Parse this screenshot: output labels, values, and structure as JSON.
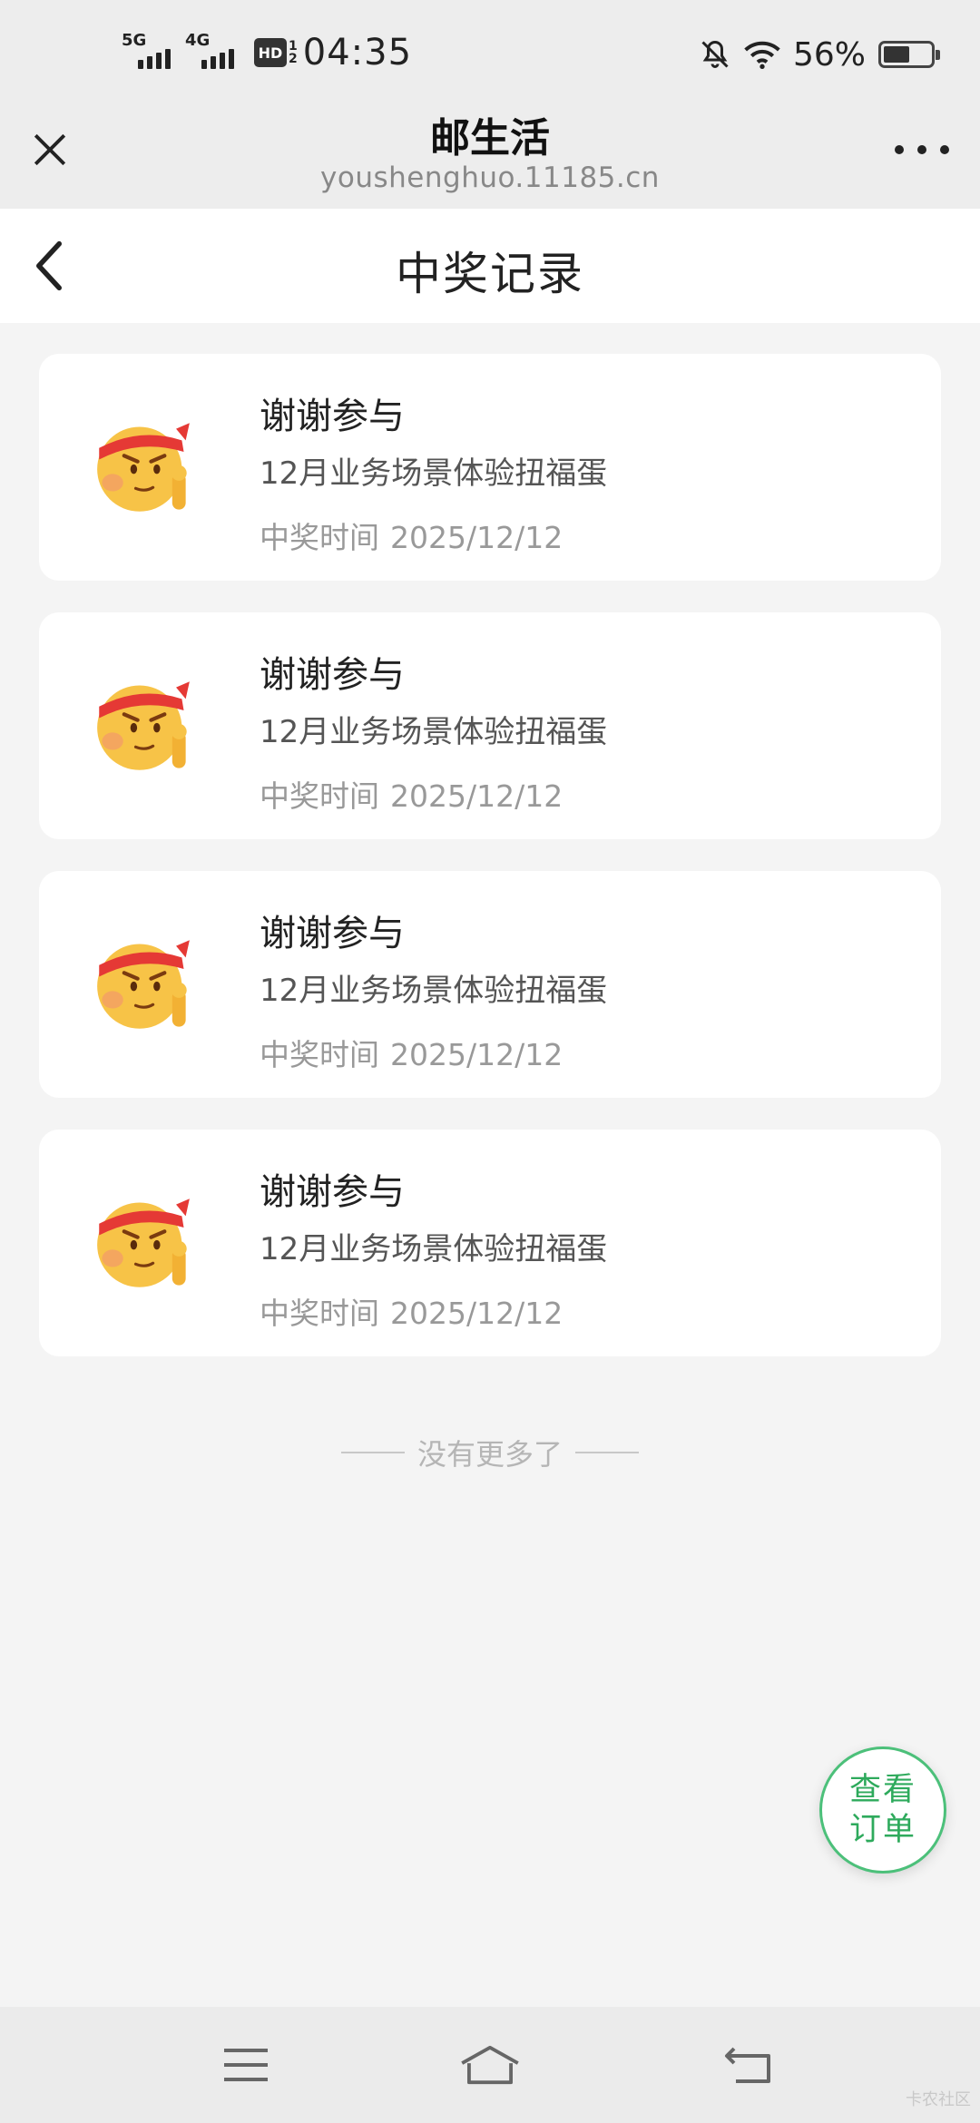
{
  "status_bar": {
    "net1": "5G",
    "net2": "4G",
    "hd": "HD",
    "hd_sub_top": "1",
    "hd_sub_bottom": "2",
    "time": "04:35",
    "battery_percent": "56%",
    "battery_level": 0.56,
    "icons": [
      "mute-bell-icon",
      "wifi-icon",
      "battery-icon"
    ]
  },
  "browser": {
    "title": "邮生活",
    "url": "youshenghuo.11185.cn"
  },
  "page": {
    "title": "中奖记录"
  },
  "records": [
    {
      "title": "谢谢参与",
      "activity": "12月业务场景体验扭福蛋",
      "time_label": "中奖时间",
      "time": "2025/12/12"
    },
    {
      "title": "谢谢参与",
      "activity": "12月业务场景体验扭福蛋",
      "time_label": "中奖时间",
      "time": "2025/12/12"
    },
    {
      "title": "谢谢参与",
      "activity": "12月业务场景体验扭福蛋",
      "time_label": "中奖时间",
      "time": "2025/12/12"
    },
    {
      "title": "谢谢参与",
      "activity": "12月业务场景体验扭福蛋",
      "time_label": "中奖时间",
      "time": "2025/12/12"
    }
  ],
  "list_end_text": "没有更多了",
  "fab": {
    "line1": "查看",
    "line2": "订单"
  },
  "watermark": "卡农社区",
  "colors": {
    "accent_green": "#2eaa5c",
    "emoji_face": "#f7c347",
    "headband": "#e53935"
  }
}
